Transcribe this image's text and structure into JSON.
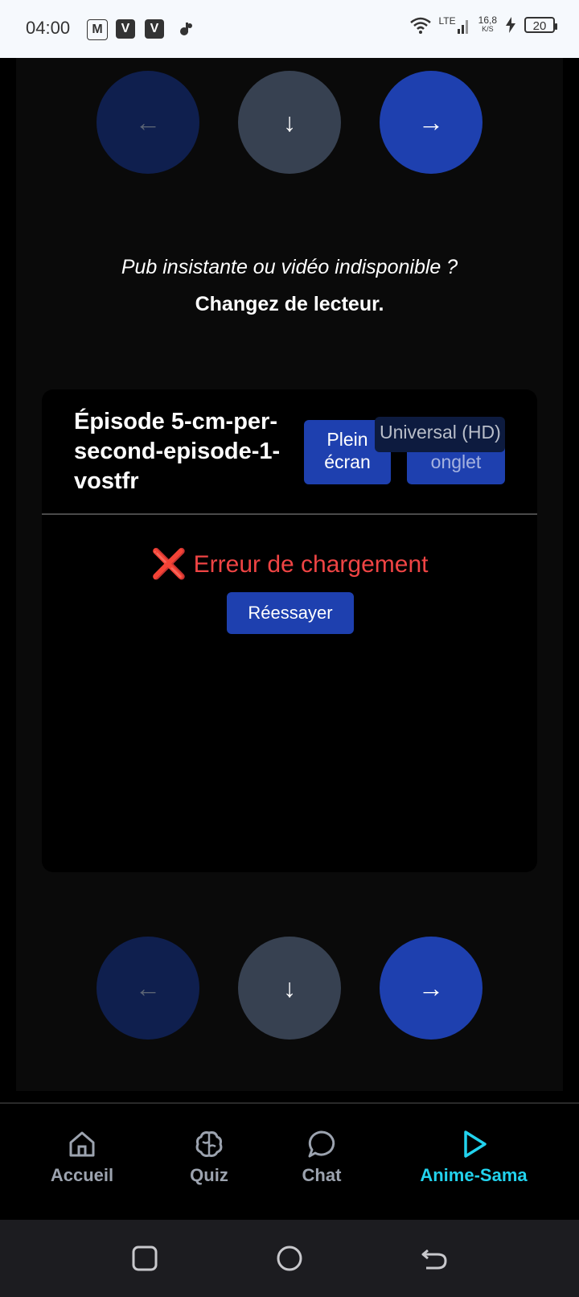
{
  "status_bar": {
    "time": "04:00",
    "notif_icons": [
      "M",
      "V",
      "V"
    ],
    "network": "LTE",
    "speed_value": "16,8",
    "speed_unit": "K/S",
    "battery": "20"
  },
  "nav_buttons": {
    "prev": "←",
    "download": "↓",
    "next": "→"
  },
  "hint": {
    "question": "Pub insistante ou vidéo indisponible ?",
    "action": "Changez de lecteur."
  },
  "player": {
    "episode_title": "Épisode 5-cm-per-second-episode-1-vostfr",
    "fullscreen_label": "Plein écran",
    "new_tab_label": "Nouvel onglet",
    "server_label": "Universal (HD)",
    "error_icon": "❌",
    "error_text": "Erreur de chargement",
    "retry_label": "Réessayer"
  },
  "tabbar": {
    "items": [
      {
        "label": "Accueil",
        "icon": "home-icon"
      },
      {
        "label": "Quiz",
        "icon": "brain-icon"
      },
      {
        "label": "Chat",
        "icon": "chat-bubble-icon"
      },
      {
        "label": "Anime-Sama",
        "icon": "play-icon",
        "active": true
      }
    ]
  },
  "colors": {
    "accent_blue": "#1e40af",
    "active_tab": "#22d3ee",
    "error": "#ef4444"
  }
}
